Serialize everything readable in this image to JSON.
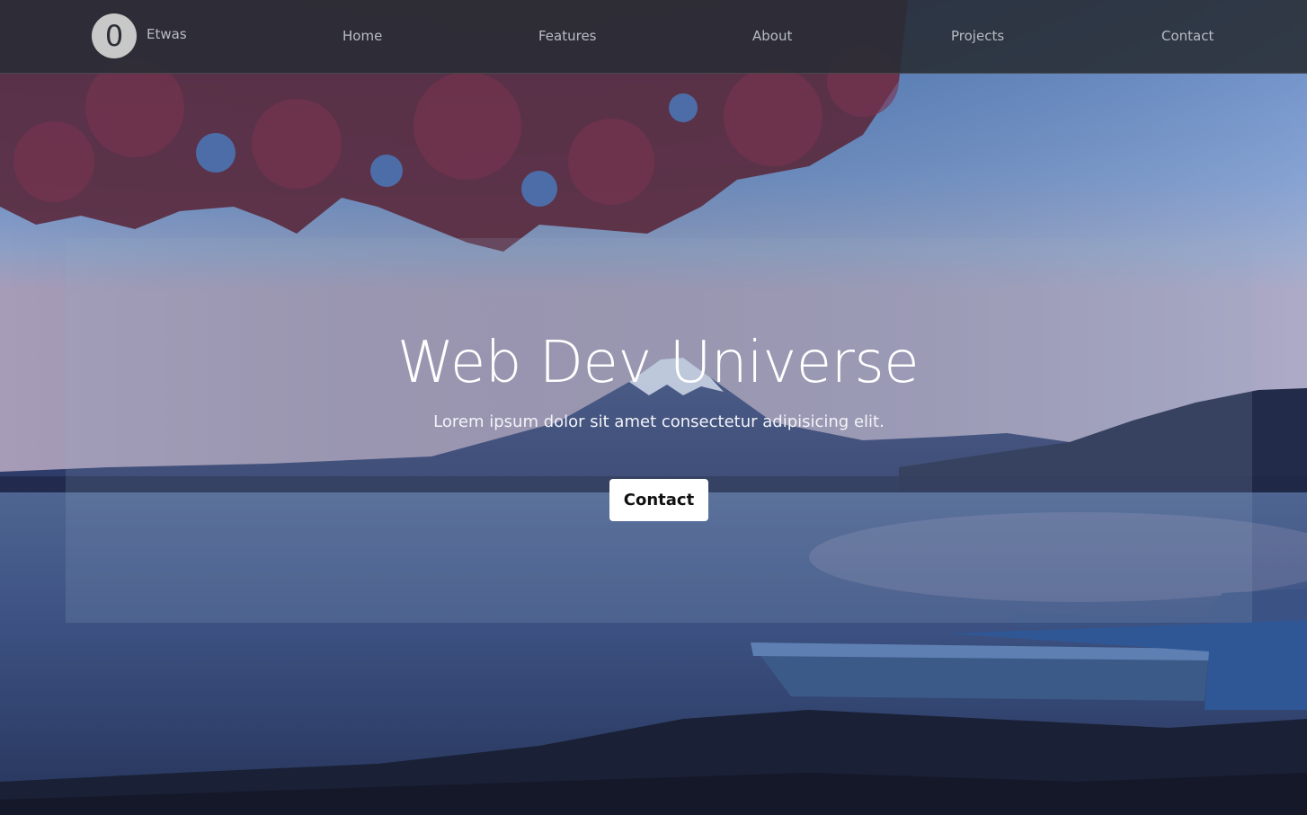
{
  "brand": {
    "logo_letter": "0",
    "name": "Etwas"
  },
  "nav": {
    "items": [
      {
        "label": "Home"
      },
      {
        "label": "Features"
      },
      {
        "label": "About"
      },
      {
        "label": "Projects"
      },
      {
        "label": "Contact"
      }
    ]
  },
  "hero": {
    "title": "Web Dev Universe",
    "subtitle": "Lorem ipsum dolor sit amet consectetur adipisicing elit.",
    "cta_label": "Contact"
  },
  "colors": {
    "navbar": "#282c34",
    "nav_text": "#b9bcc2",
    "button_bg": "#ffffff",
    "button_text": "#111111"
  },
  "icons": {
    "logo": "circle-logo"
  }
}
